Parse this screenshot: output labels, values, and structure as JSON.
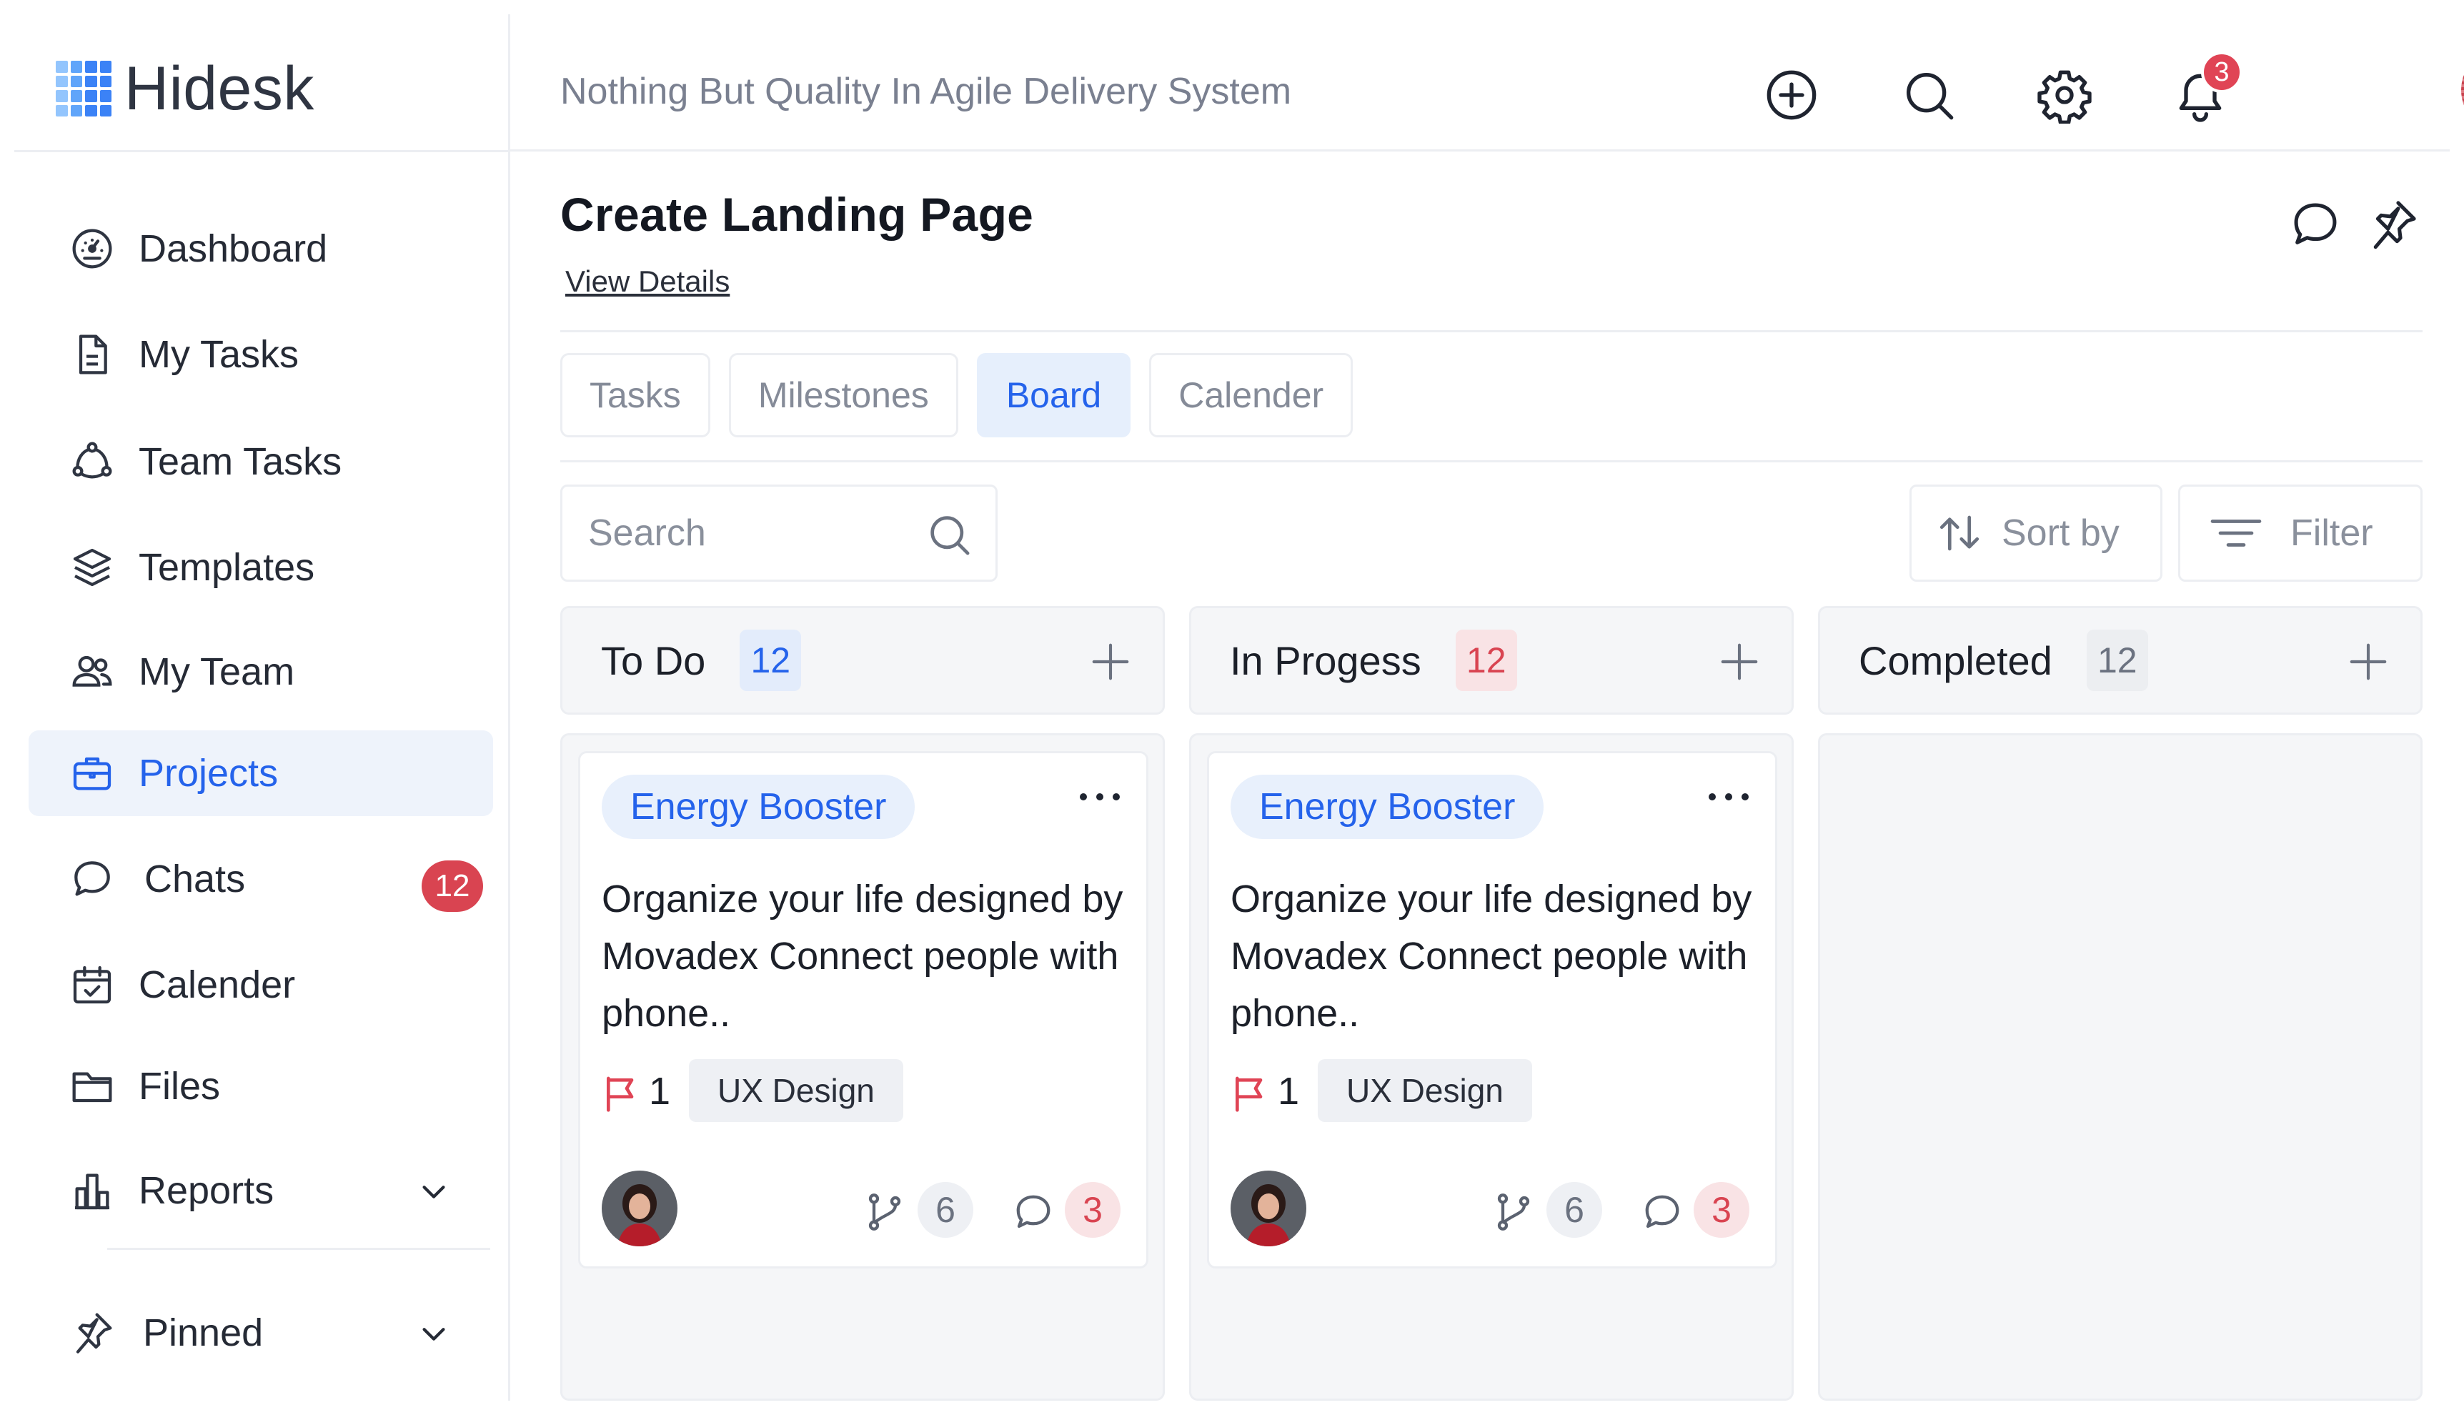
{
  "app": {
    "name": "Hidesk",
    "tagline": "Nothing But Quality In Agile Delivery System"
  },
  "header": {
    "notification_count": "3",
    "icons": [
      "plus-circle-icon",
      "search-icon",
      "gear-icon",
      "bell-icon"
    ]
  },
  "sidebar": {
    "items": [
      {
        "label": "Dashboard",
        "icon": "dashboard-gauge-icon"
      },
      {
        "label": "My Tasks",
        "icon": "document-icon"
      },
      {
        "label": "Team Tasks",
        "icon": "team-network-icon"
      },
      {
        "label": "Templates",
        "icon": "layers-icon"
      },
      {
        "label": "My Team",
        "icon": "users-icon"
      },
      {
        "label": "Projects",
        "icon": "briefcase-icon",
        "active": true
      },
      {
        "label": "Chats",
        "icon": "chat-icon",
        "badge": "12"
      },
      {
        "label": "Calender",
        "icon": "calendar-check-icon"
      },
      {
        "label": "Files",
        "icon": "folder-icon"
      },
      {
        "label": "Reports",
        "icon": "bar-chart-icon",
        "expandable": true
      }
    ],
    "pinned_label": "Pinned"
  },
  "page": {
    "title": "Create Landing Page",
    "view_details": "View Details"
  },
  "tabs": [
    {
      "label": "Tasks"
    },
    {
      "label": "Milestones"
    },
    {
      "label": "Board",
      "active": true
    },
    {
      "label": "Calender"
    }
  ],
  "toolbar": {
    "search_placeholder": "Search",
    "sort_label": "Sort by",
    "filter_label": "Filter"
  },
  "board": {
    "columns": [
      {
        "title": "To Do",
        "count": "12",
        "count_color": "#2563eb",
        "count_bg": "#e3ecfb"
      },
      {
        "title": "In Progess",
        "count": "12",
        "count_color": "#d94451",
        "count_bg": "#f9e3e5"
      },
      {
        "title": "Completed",
        "count": "12",
        "count_color": "#6b7280",
        "count_bg": "#eceef1"
      }
    ],
    "cards": [
      {
        "tag": "Energy Booster",
        "description": "Organize your life designed by Movadex Connect people with phone..",
        "priority": "1",
        "label": "UX Design",
        "branches": "6",
        "comments": "3"
      },
      {
        "tag": "Energy Booster",
        "description": "Organize your life designed by Movadex Connect people with phone..",
        "priority": "1",
        "label": "UX Design",
        "branches": "6",
        "comments": "3"
      }
    ]
  },
  "colors": {
    "accent": "#2563eb",
    "danger": "#e04455",
    "active_bg": "#eef3fb"
  }
}
